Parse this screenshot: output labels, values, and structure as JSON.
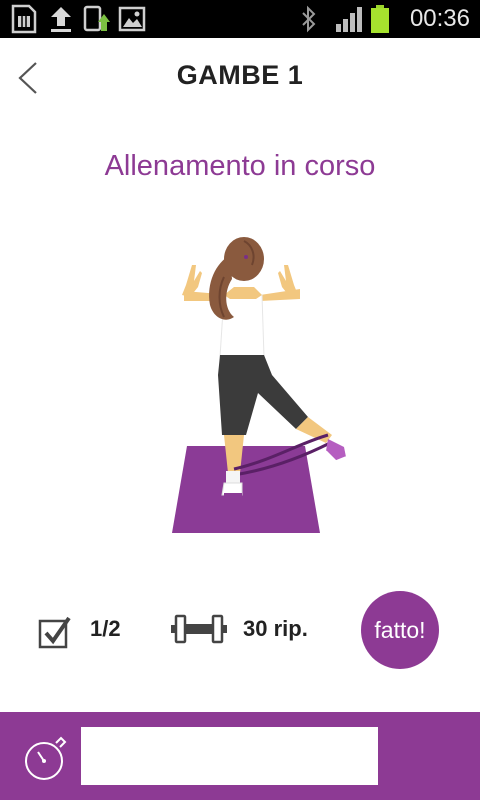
{
  "status_bar": {
    "time": "00:36",
    "icons": [
      "sim-card-icon",
      "upload-icon",
      "phone-sync-icon",
      "gallery-icon",
      "bluetooth-icon",
      "signal-icon",
      "battery-icon"
    ],
    "battery_color": "#a6e22e"
  },
  "header": {
    "title": "GAMBE 1",
    "back_icon": "chevron-left-icon"
  },
  "workout": {
    "status": "Allenamento in corso",
    "illustration": "woman-leg-exercise-with-resistance-band"
  },
  "stats": {
    "sets": "1/2",
    "reps": "30 rip.",
    "sets_icon": "checkbox-checked-icon",
    "reps_icon": "dumbbell-icon"
  },
  "done_button": {
    "label": "fatto!"
  },
  "footer": {
    "timer_value": "",
    "stopwatch_icon": "stopwatch-icon"
  },
  "colors": {
    "accent": "#8d3a94",
    "mat": "#8b3b96",
    "text_dark": "#222222"
  }
}
